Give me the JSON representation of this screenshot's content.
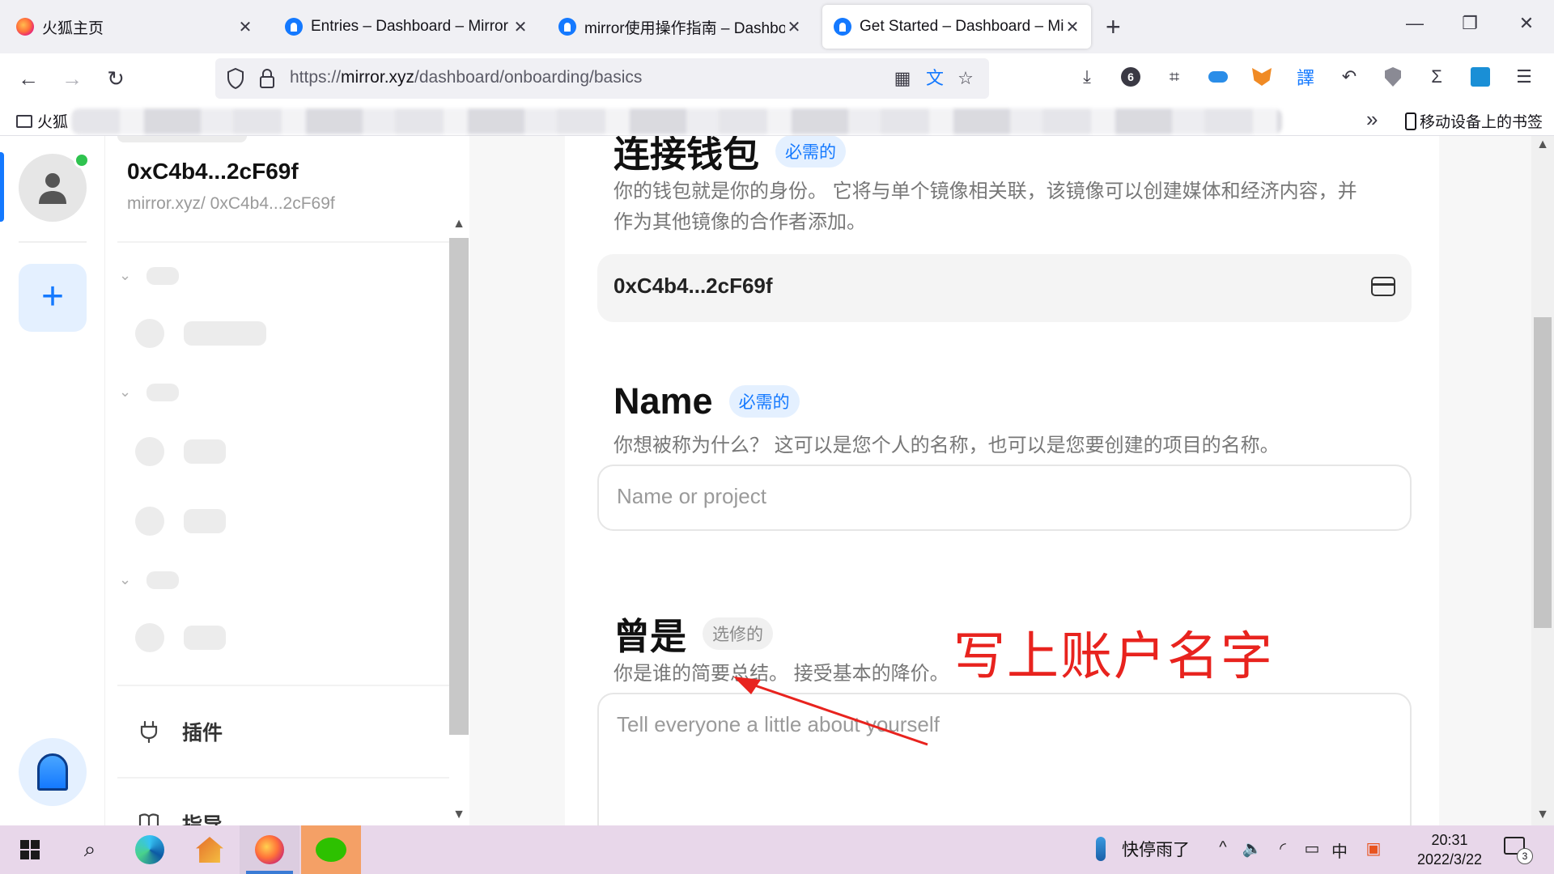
{
  "browser": {
    "tabs": [
      {
        "title": "火狐主页",
        "favicon": "firefox-icon",
        "active": false
      },
      {
        "title": "Entries – Dashboard – Mirror",
        "favicon": "mirror-icon",
        "active": false
      },
      {
        "title": "mirror使用操作指南 – Dashboard",
        "favicon": "mirror-icon",
        "active": false
      },
      {
        "title": "Get Started – Dashboard – Mirror",
        "favicon": "mirror-icon",
        "active": true
      }
    ],
    "url": {
      "scheme": "https://",
      "host": "mirror.xyz",
      "path": "/dashboard/onboarding/basics"
    },
    "extension_badge": "6",
    "bookmarks": {
      "folder_label": "火狐",
      "mobile_label": "移动设备上的书签"
    }
  },
  "sidebar": {
    "account_name": "0xC4b4...2cF69f",
    "account_url": "mirror.xyz/ 0xC4b4...2cF69f",
    "items": [
      {
        "label": "插件",
        "icon": "plug-icon"
      },
      {
        "label": "指导",
        "icon": "book-icon"
      }
    ]
  },
  "form": {
    "wallet": {
      "title": "连接钱包",
      "badge": "必需的",
      "description": "你的钱包就是你的身份。 它将与单个镜像相关联，该镜像可以创建媒体和经济内容，并作为其他镜像的合作者添加。",
      "address": "0xC4b4...2cF69f"
    },
    "name": {
      "title": "Name",
      "badge": "必需的",
      "description": "你想被称为什么？ 这可以是您个人的名称，也可以是您要创建的项目的名称。",
      "placeholder": "Name or project",
      "value": ""
    },
    "bio": {
      "title": "曾是",
      "badge": "选修的",
      "description": "你是谁的简要总结。 接受基本的降价。",
      "placeholder": "Tell everyone a little about yourself",
      "value": ""
    }
  },
  "annotation": {
    "text": "写上账户名字",
    "color": "#e8231e"
  },
  "taskbar": {
    "weather": "快停雨了",
    "ime": "中",
    "time": "20:31",
    "date": "2022/3/22",
    "notification_count": "3"
  },
  "colors": {
    "accent": "#1479ff",
    "online": "#2fc34f"
  }
}
